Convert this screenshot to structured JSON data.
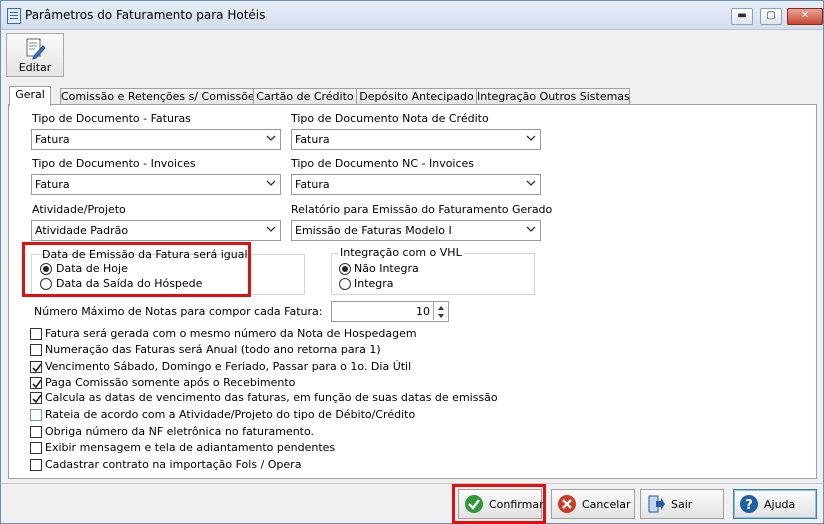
{
  "window": {
    "title": "Parâmetros do Faturamento para Hotéis",
    "controls": {
      "minimize": "▬",
      "maximize": "▢",
      "close": "✕"
    }
  },
  "toolbar": {
    "edit_label": "Editar"
  },
  "tabs": [
    {
      "label": "Geral",
      "active": true
    },
    {
      "label": "Comissão e Retenções s/ Comissões",
      "active": false
    },
    {
      "label": "Cartão de Crédito",
      "active": false
    },
    {
      "label": "Depósito Antecipado",
      "active": false
    },
    {
      "label": "Integração Outros Sistemas",
      "active": false
    }
  ],
  "fields": {
    "tipo_doc_faturas": {
      "label": "Tipo de Documento - Faturas",
      "value": "Fatura"
    },
    "tipo_doc_nota_credito": {
      "label": "Tipo de Documento Nota de Crédito",
      "value": "Fatura"
    },
    "tipo_doc_invoices": {
      "label": "Tipo de Documento - Invoices",
      "value": "Fatura"
    },
    "tipo_doc_nc_invoices": {
      "label": "Tipo de Documento NC - Invoices",
      "value": "Fatura"
    },
    "atividade_projeto": {
      "label": "Atividade/Projeto",
      "value": "Atividade Padrão"
    },
    "relatorio_emissao": {
      "label": "Relatório para Emissão do Faturamento Gerado",
      "value": "Emissão de Faturas Modelo I"
    }
  },
  "data_emissao_group": {
    "legend": "Data de Emissão da Fatura será igual",
    "options": [
      {
        "label": "Data de Hoje",
        "selected": true
      },
      {
        "label": "Data da Saída do Hóspede",
        "selected": false
      }
    ]
  },
  "integracao_vhl_group": {
    "legend": "Integração com o VHL",
    "options": [
      {
        "label": "Não Integra",
        "selected": true
      },
      {
        "label": "Integra",
        "selected": false
      }
    ]
  },
  "max_notas": {
    "label": "Número Máximo de Notas para compor cada Fatura:",
    "value": "10"
  },
  "checkboxes": [
    {
      "label": "Fatura será gerada com o mesmo número da Nota de Hospedagem",
      "checked": false
    },
    {
      "label": "Numeração das Faturas será Anual (todo ano retorna para 1)",
      "checked": false
    },
    {
      "label": "Vencimento Sábado, Domingo e Feriado, Passar para o 1o. Dia Útil",
      "checked": true
    },
    {
      "label": "Paga Comissão somente após o Recebimento",
      "checked": true
    },
    {
      "label": "Calcula as datas de vencimento das faturas,  em função de suas datas de emissão",
      "checked": true
    },
    {
      "label": "Rateia de acordo com a Atividade/Projeto do tipo de Débito/Crédito",
      "checked": false
    },
    {
      "label": "Obriga número da NF eletrônica no faturamento.",
      "checked": false
    },
    {
      "label": "Exibir mensagem e tela de adiantamento pendentes",
      "checked": false
    },
    {
      "label": "Cadastrar contrato na importação Fols / Opera",
      "checked": false
    }
  ],
  "buttons": {
    "confirmar": "Confirmar",
    "cancelar": "Cancelar",
    "sair": "Sair",
    "ajuda": "Ajuda"
  },
  "colors": {
    "highlight": "#e01010",
    "confirm_green": "#2e9a3a",
    "cancel_red": "#d03a2a",
    "help_blue": "#1f5fa8"
  }
}
